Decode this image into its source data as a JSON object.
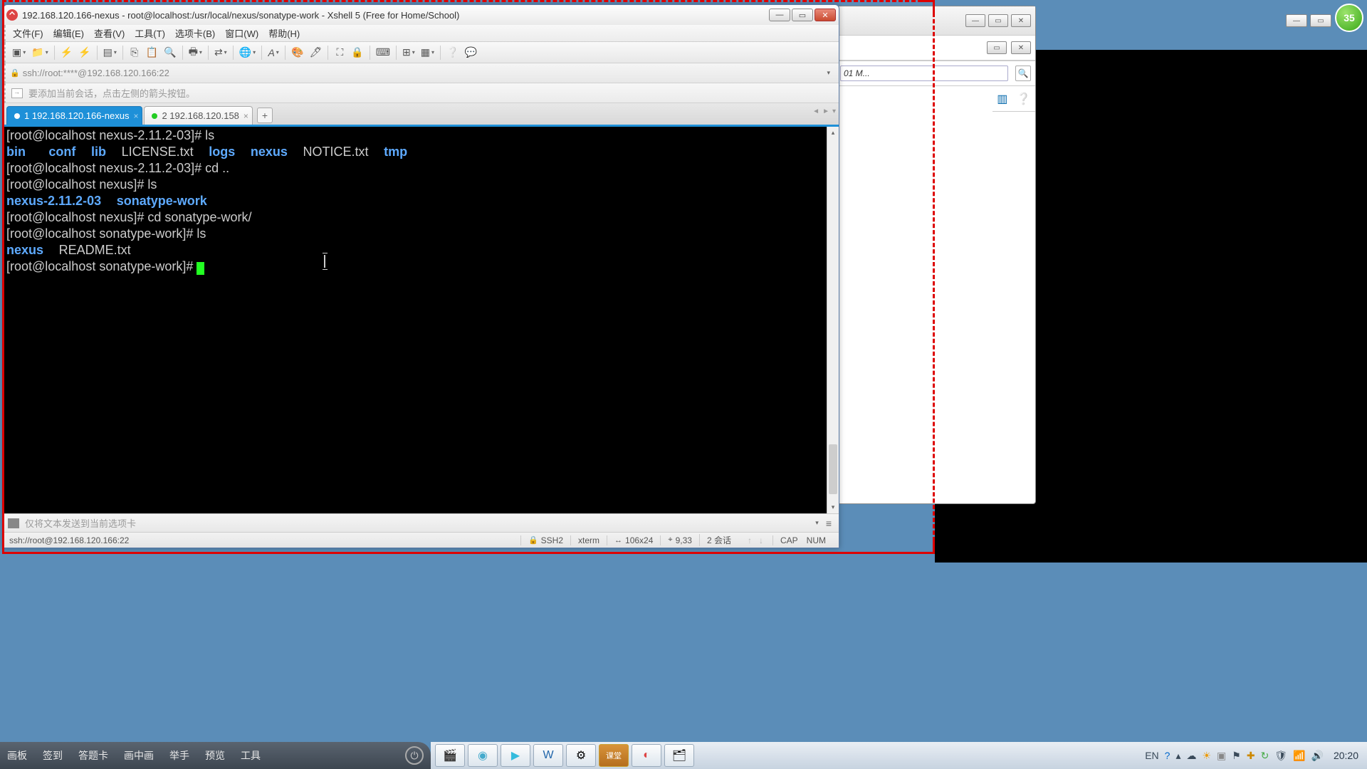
{
  "window": {
    "title": "192.168.120.166-nexus - root@localhost:/usr/local/nexus/sonatype-work - Xshell 5 (Free for Home/School)"
  },
  "menu": {
    "file": "文件(F)",
    "edit": "编辑(E)",
    "view": "查看(V)",
    "tools": "工具(T)",
    "tabs": "选项卡(B)",
    "window": "窗口(W)",
    "help": "帮助(H)"
  },
  "address": {
    "url": "ssh://root:****@192.168.120.166:22"
  },
  "infobar": {
    "text": "要添加当前会话，点击左侧的箭头按钮。"
  },
  "tabs": {
    "t1": "1 192.168.120.166-nexus",
    "t2": "2 192.168.120.158"
  },
  "terminal": {
    "p1": "[root@localhost nexus-2.11.2-03]# ",
    "c1": "ls",
    "l2_bin": "bin",
    "l2_conf": "conf",
    "l2_lib": "lib",
    "l2_lic": "LICENSE.txt",
    "l2_logs": "logs",
    "l2_nexus": "nexus",
    "l2_notice": "NOTICE.txt",
    "l2_tmp": "tmp",
    "p3": "[root@localhost nexus-2.11.2-03]# ",
    "c3": "cd ..",
    "p4": "[root@localhost nexus]# ",
    "c4": "ls",
    "l5_a": "nexus-2.11.2-03",
    "l5_b": "sonatype-work",
    "p6": "[root@localhost nexus]# ",
    "c6": "cd sonatype-work/",
    "p7": "[root@localhost sonatype-work]# ",
    "c7": "ls",
    "l8_a": "nexus",
    "l8_b": "README.txt",
    "p9": "[root@localhost sonatype-work]# "
  },
  "sendbar": {
    "placeholder": "仅将文本发送到当前选项卡"
  },
  "statusbar": {
    "left": "ssh://root@192.168.120.166:22",
    "proto": "SSH2",
    "term": "xterm",
    "size": "106x24",
    "pos": "9,33",
    "sessions": "2 会话",
    "caps": "CAP",
    "num": "NUM"
  },
  "presenter": {
    "b1": "画板",
    "b2": "签到",
    "b3": "答题卡",
    "b4": "画中画",
    "b5": "举手",
    "b6": "预览",
    "b7": "工具"
  },
  "bgwin": {
    "addr": "01 M..."
  },
  "tray": {
    "ime": "EN",
    "clock": "20:20"
  },
  "badge": {
    "n": "35"
  }
}
